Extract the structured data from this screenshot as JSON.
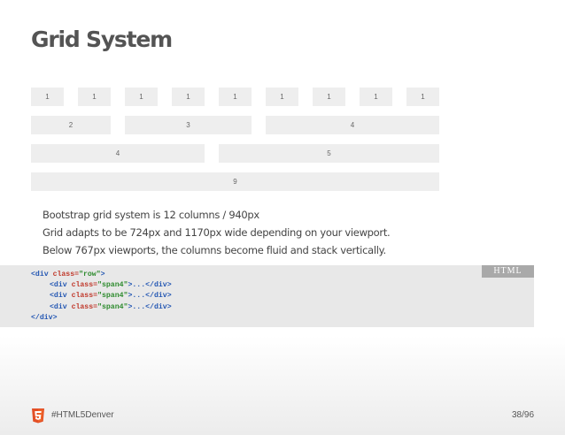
{
  "slide": {
    "title": "Grid System",
    "bullets": [
      "Bootstrap grid system is 12 columns / 940px",
      "Grid adapts to be 724px and 1170px wide depending on your viewport.",
      "Below 767px viewports, the columns become fluid and stack vertically."
    ]
  },
  "grid_demo": {
    "rows": [
      [
        "1",
        "1",
        "1",
        "1",
        "1",
        "1",
        "1",
        "1",
        "1"
      ],
      [
        "2",
        "3",
        "4"
      ],
      [
        "4",
        "5"
      ],
      [
        "9"
      ]
    ]
  },
  "code": {
    "language_badge": "HTML",
    "open_tag": "<div",
    "class_attr": " class=",
    "row_value": "\"row\"",
    "span4_value": "\"span4\"",
    "tag_close": ">",
    "inner_close": ">...</div>",
    "end_tag": "</div>"
  },
  "footer": {
    "hashtag": "#HTML5Denver",
    "page_number": "38/96"
  },
  "colors": {
    "badge": "#a9a9a9",
    "code_bg": "#e8e8e8",
    "tag": "#2457b3",
    "attr": "#c0392b",
    "value": "#2e8b2e",
    "html5_logo": "#e34f26"
  },
  "icons": {
    "footer_logo": "html5-logo-icon"
  }
}
